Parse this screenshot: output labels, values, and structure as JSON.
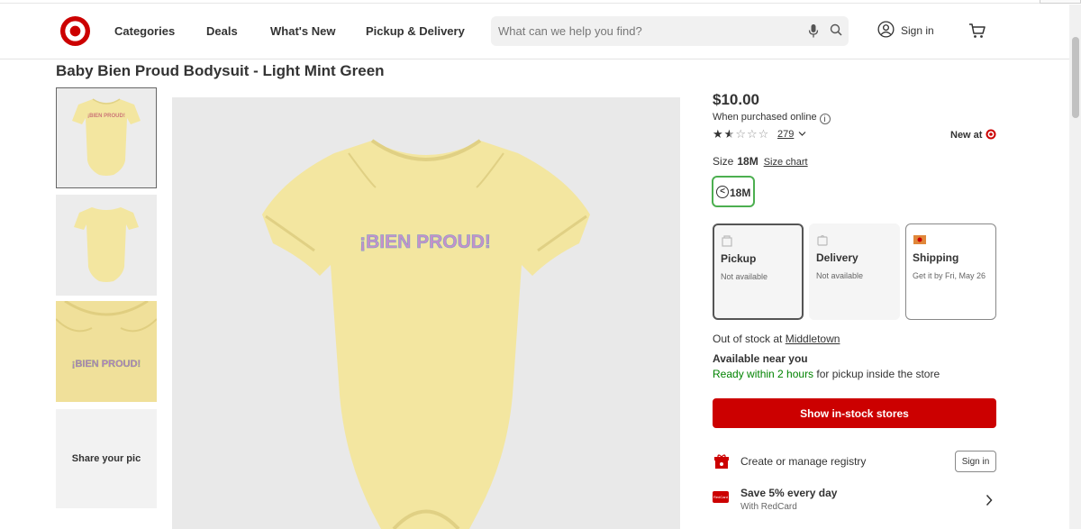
{
  "header": {
    "nav": [
      "Categories",
      "Deals",
      "What's New",
      "Pickup & Delivery"
    ],
    "search_placeholder": "What can we help you find?",
    "sign_in": "Sign in"
  },
  "product": {
    "title": "Baby Bien Proud Bodysuit - Light Mint Green",
    "graphic_text": "¡BIEN PROUD!",
    "price": "$10.00",
    "price_note": "When purchased online",
    "rating": 1.5,
    "rating_max": 5,
    "review_count": "279",
    "new_at": "New at",
    "size_label": "Size",
    "size_value": "18M",
    "size_chart": "Size chart",
    "size_option": "18M"
  },
  "thumbnails": {
    "share_label": "Share your pic"
  },
  "fulfillment": [
    {
      "title": "Pickup",
      "status": "Not available",
      "selected": true
    },
    {
      "title": "Delivery",
      "status": "Not available",
      "selected": false
    },
    {
      "title": "Shipping",
      "status": "Get it by Fri, May 26",
      "selected": false
    }
  ],
  "store": {
    "out_of_stock": "Out of stock at",
    "store_name": "Middletown",
    "available_near": "Available near you",
    "ready_green": "Ready within 2 hours",
    "ready_rest": "for pickup inside the store",
    "button": "Show in-stock stores"
  },
  "registry": {
    "label": "Create or manage registry",
    "button": "Sign in"
  },
  "redcard": {
    "title": "Save 5% every day",
    "subtitle": "With RedCard"
  },
  "colors": {
    "brand_red": "#cc0000",
    "success_green": "#008300",
    "selected_size_border": "#4caf50",
    "bodysuit_yellow": "#f3e6a0"
  }
}
